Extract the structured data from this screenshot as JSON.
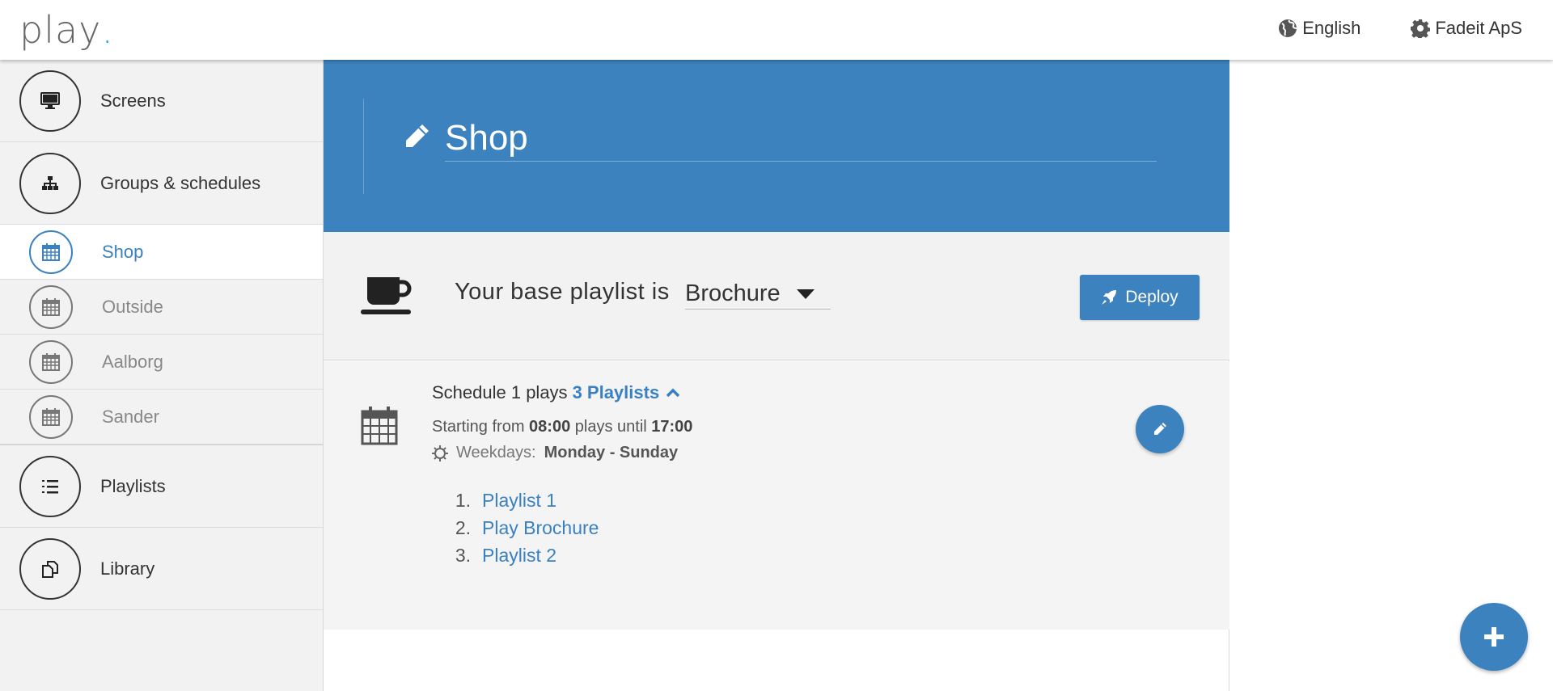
{
  "header": {
    "logo_text": "play",
    "logo_dot": ".",
    "language_label": "English",
    "account_label": "Fadeit ApS",
    "language_icon": "globe-icon",
    "account_icon": "gear-icon"
  },
  "sidebar": {
    "items": [
      {
        "label": "Screens",
        "icon": "monitor-icon"
      },
      {
        "label": "Groups & schedules",
        "icon": "sitemap-icon"
      },
      {
        "label": "Playlists",
        "icon": "list-icon"
      },
      {
        "label": "Library",
        "icon": "files-icon"
      }
    ],
    "groups": [
      {
        "label": "Shop",
        "icon": "calendar-icon",
        "active": true
      },
      {
        "label": "Outside",
        "icon": "calendar-icon",
        "active": false
      },
      {
        "label": "Aalborg",
        "icon": "calendar-icon",
        "active": false
      },
      {
        "label": "Sander",
        "icon": "calendar-icon",
        "active": false
      }
    ]
  },
  "main": {
    "title": "Shop",
    "base_playlist_prefix": "Your base playlist is",
    "base_playlist_value": "Brochure",
    "deploy_label": "Deploy",
    "schedule": {
      "prefix": "Schedule 1 plays",
      "playlists_link": "3 Playlists",
      "starting_from": "Starting from",
      "start_time": "08:00",
      "plays_until": "plays until",
      "end_time": "17:00",
      "weekdays_label": "Weekdays:",
      "weekdays_value": "Monday - Sunday",
      "playlists": [
        {
          "num": "1.",
          "name": "Playlist 1"
        },
        {
          "num": "2.",
          "name": "Play Brochure"
        },
        {
          "num": "3.",
          "name": "Playlist 2"
        }
      ]
    }
  },
  "colors": {
    "accent": "#3c82be",
    "logo_dot": "#1aa3e8",
    "sidebar_bg": "#f2f2f2"
  }
}
